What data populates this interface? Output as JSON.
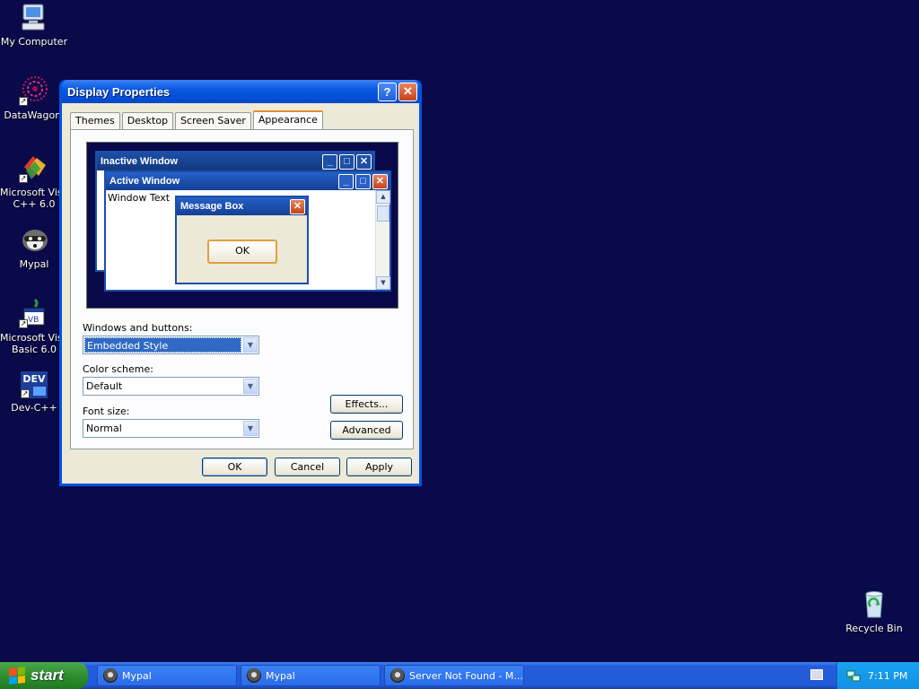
{
  "desktop": {
    "icons": [
      {
        "label": "My Computer",
        "icon": "computer-icon"
      },
      {
        "label": "DataWagon.",
        "icon": "datawagon-icon"
      },
      {
        "label": "Microsoft Visu",
        "label2": "C++ 6.0",
        "icon": "visual-cpp-icon"
      },
      {
        "label": "Mypal",
        "icon": "mypal-icon"
      },
      {
        "label": "Microsoft Visu",
        "label2": "Basic 6.0",
        "icon": "visual-basic-icon"
      },
      {
        "label": "Dev-C++",
        "icon": "dev-cpp-icon",
        "badge": "DEV"
      },
      {
        "label": "Recycle Bin",
        "icon": "recycle-bin-icon"
      }
    ]
  },
  "dialog": {
    "title": "Display Properties",
    "help_glyph": "?",
    "close_glyph": "✕",
    "tabs": [
      "Themes",
      "Desktop",
      "Screen Saver",
      "Appearance"
    ],
    "active_tab": "Appearance",
    "preview": {
      "inactive_title": "Inactive Window",
      "active_title": "Active Window",
      "window_text": "Window Text",
      "message_box_title": "Message Box",
      "message_ok": "OK"
    },
    "windows_buttons_label": "Windows and buttons:",
    "windows_buttons_value": "Embedded Style",
    "color_scheme_label": "Color scheme:",
    "color_scheme_value": "Default",
    "font_size_label": "Font size:",
    "font_size_value": "Normal",
    "effects_button": "Effects...",
    "advanced_button": "Advanced",
    "ok_button": "OK",
    "cancel_button": "Cancel",
    "apply_button": "Apply"
  },
  "taskbar": {
    "start_label": "start",
    "tasks": [
      "Mypal",
      "Mypal",
      "Server Not Found - M..."
    ],
    "clock": "7:11 PM"
  },
  "colors": {
    "desktop_bg": "#0a0a4a",
    "xp_blue": "#0054e3",
    "dialog_face": "#ece9d8",
    "tab_accent": "#e68b2c"
  }
}
